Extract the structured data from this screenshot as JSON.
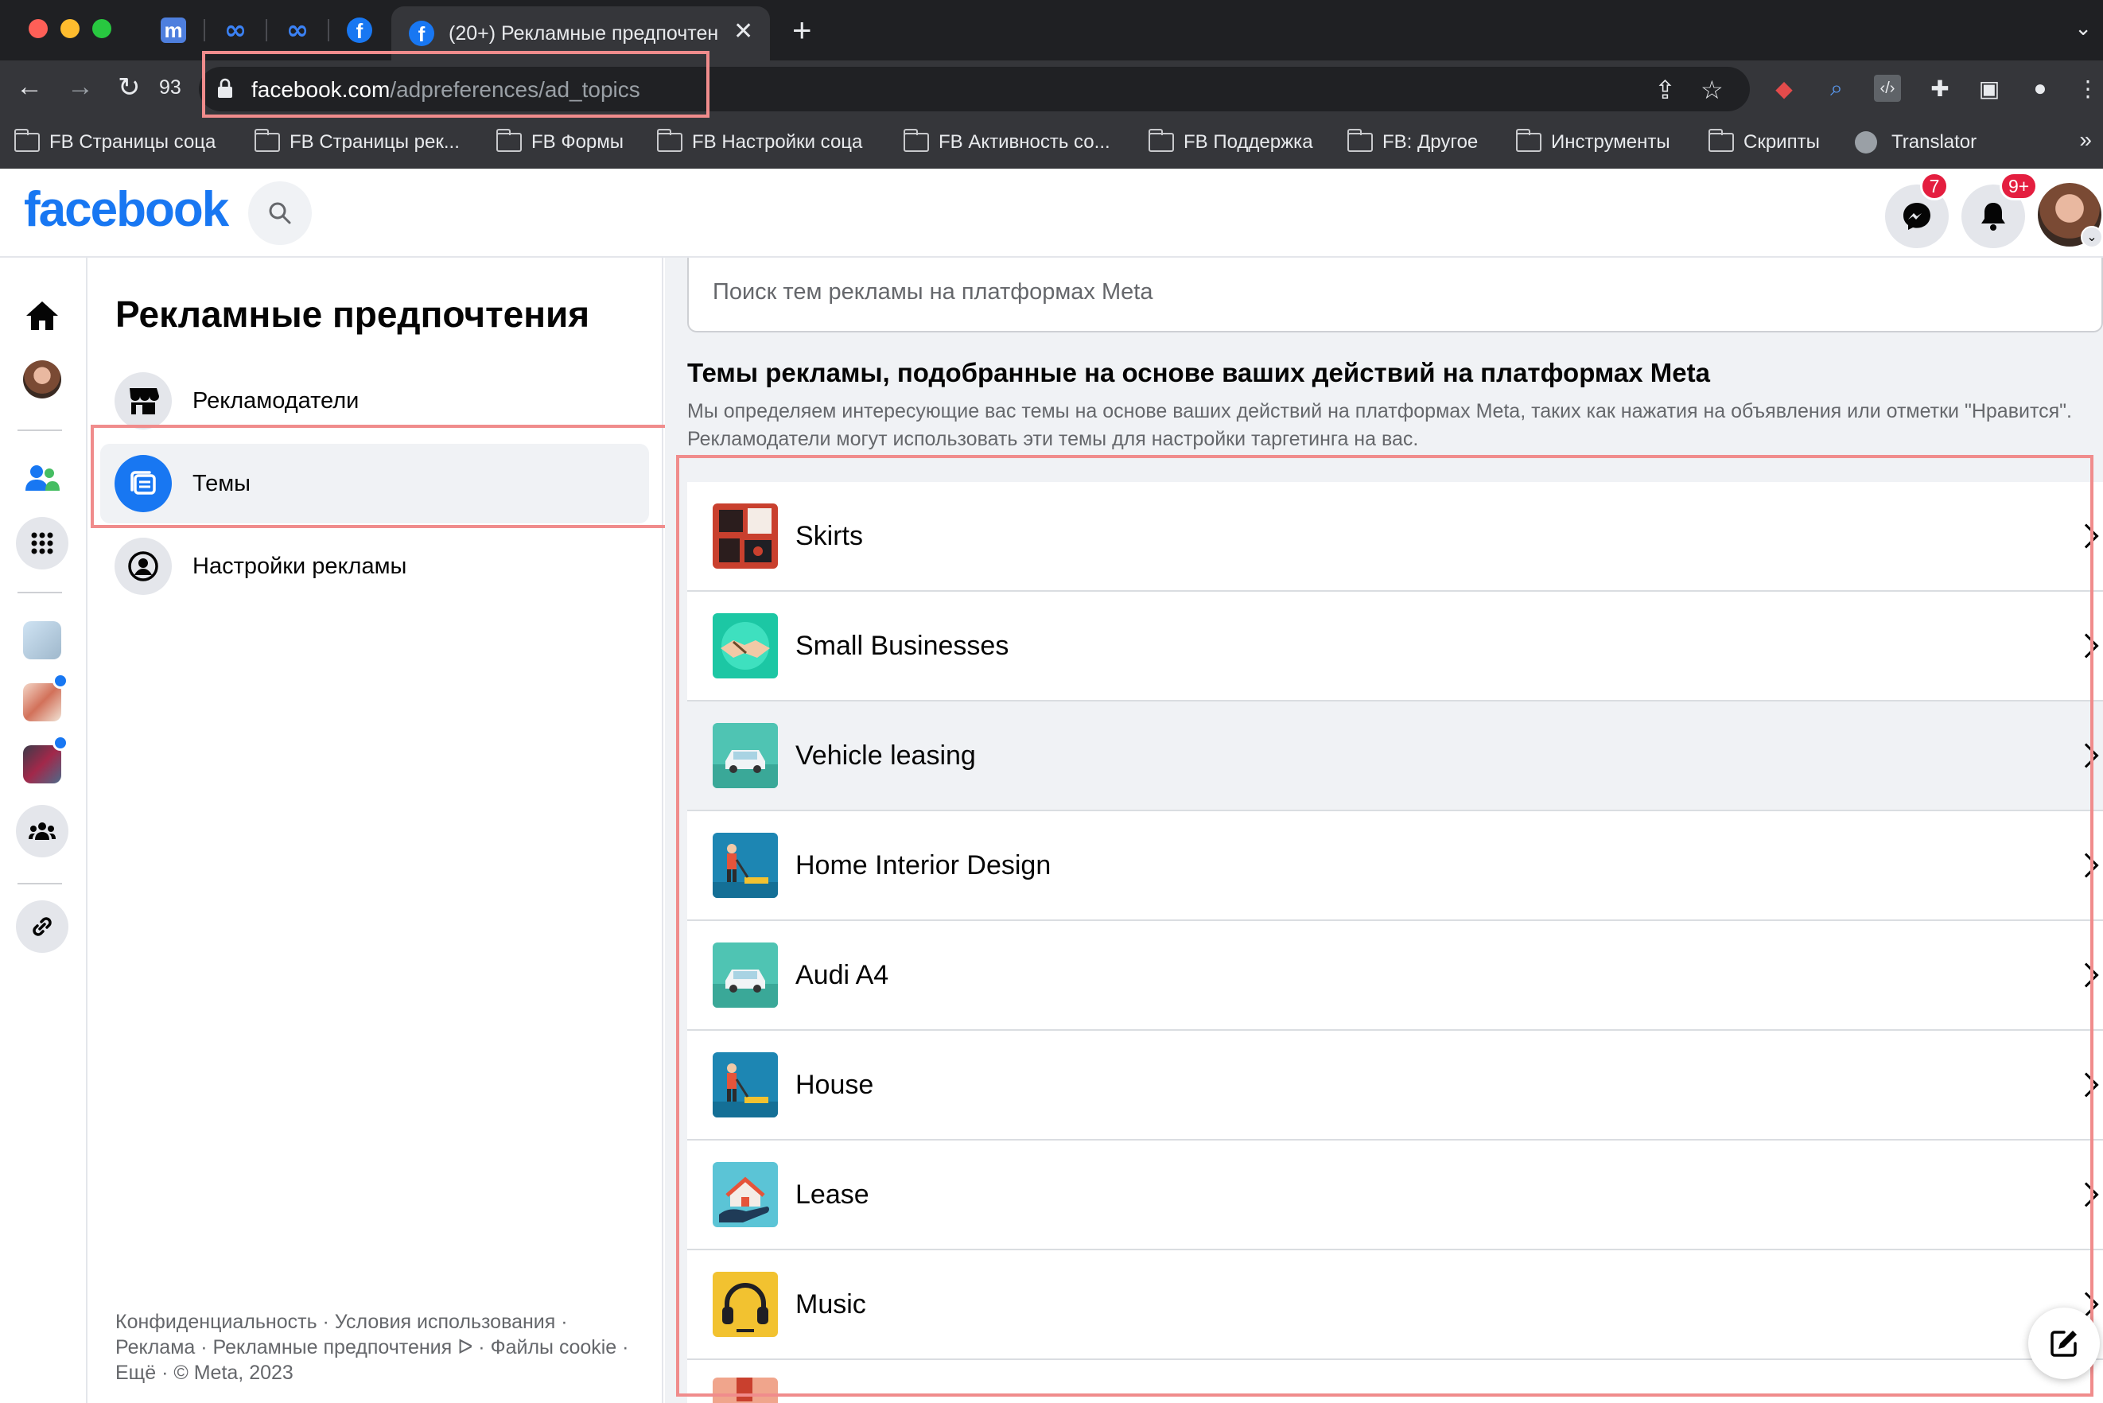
{
  "browser": {
    "active_tab_title": "(20+) Рекламные предпочтен",
    "pinned_tabs": [
      {
        "icon": "m-favicon"
      },
      {
        "icon": "meta-favicon"
      },
      {
        "icon": "meta-favicon"
      },
      {
        "icon": "facebook-favicon"
      }
    ],
    "reload_count": "93",
    "url_host": "facebook.com",
    "url_path": "/adpreferences/ad_topics",
    "bookmarks": [
      {
        "label": "FB Страницы соца",
        "icon": "folder-icon"
      },
      {
        "label": "FB Страницы рек...",
        "icon": "folder-icon"
      },
      {
        "label": "FB Формы",
        "icon": "folder-icon"
      },
      {
        "label": "FB Настройки соца",
        "icon": "folder-icon"
      },
      {
        "label": "FB Активность со...",
        "icon": "folder-icon"
      },
      {
        "label": "FB Поддержка",
        "icon": "folder-icon"
      },
      {
        "label": "FB: Другое",
        "icon": "folder-icon"
      },
      {
        "label": "Инструменты",
        "icon": "folder-icon"
      },
      {
        "label": "Скрипты",
        "icon": "folder-icon"
      },
      {
        "label": "Translator",
        "icon": "globe-icon"
      }
    ],
    "bookmarks_more": "»"
  },
  "header": {
    "logo": "facebook",
    "messenger_badge": "7",
    "notifications_badge": "9+"
  },
  "settings": {
    "title": "Рекламные предпочтения",
    "nav": [
      {
        "label": "Рекламодатели",
        "icon": "storefront-icon",
        "active": false
      },
      {
        "label": "Темы",
        "icon": "topics-icon",
        "active": true
      },
      {
        "label": "Настройки рекламы",
        "icon": "account-circle-icon",
        "active": false
      }
    ],
    "footer": "Конфиденциальность · Условия использования · Реклама · Рекламные предпочтения ᐅ · Файлы cookie · Ещё · © Meta, 2023"
  },
  "main": {
    "search_placeholder": "Поиск тем рекламы на платформах Meta",
    "section_title": "Темы рекламы, подобранные на основе ваших действий на платформах Meta",
    "section_description": "Мы определяем интересующие вас темы на основе ваших действий на платформах Meta, таких как нажатия на объявления или отметки \"Нравится\". Рекламодатели могут использовать эти темы для настройки таргетинга на вас.",
    "topics": [
      {
        "name": "Skirts",
        "thumb": "clothing-thumb"
      },
      {
        "name": "Small Businesses",
        "thumb": "handshake-thumb"
      },
      {
        "name": "Vehicle leasing",
        "thumb": "car-thumb"
      },
      {
        "name": "Home Interior Design",
        "thumb": "gardener-thumb"
      },
      {
        "name": "Audi A4",
        "thumb": "car-thumb"
      },
      {
        "name": "House",
        "thumb": "gardener-thumb"
      },
      {
        "name": "Lease",
        "thumb": "house-hand-thumb"
      },
      {
        "name": "Music",
        "thumb": "headphones-thumb"
      }
    ]
  },
  "colors": {
    "facebook_blue": "#1877f2",
    "highlight": "#f08c8c",
    "badge_red": "#e41e3f"
  }
}
